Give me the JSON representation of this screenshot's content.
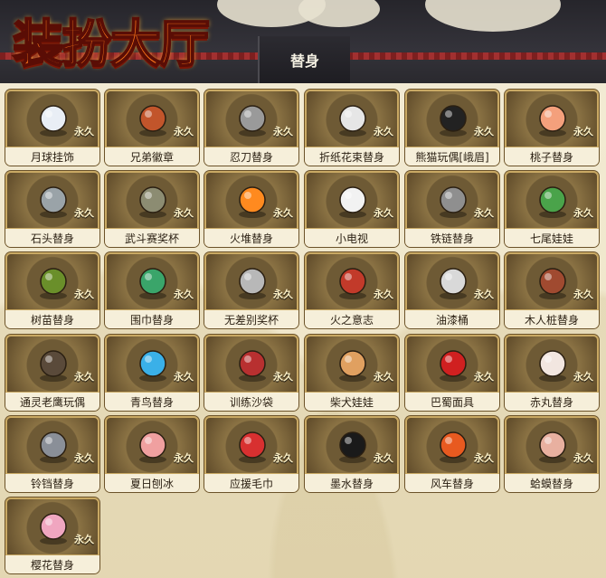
{
  "header": {
    "title": "装扮大厅",
    "tab": "替身"
  },
  "badge_label": "永久",
  "items": [
    {
      "name": "月球挂饰",
      "icon": "moon-ball-charm-icon",
      "color": "#e9eef5"
    },
    {
      "name": "兄弟徽章",
      "icon": "brother-badge-icon",
      "color": "#c2552b"
    },
    {
      "name": "忍刀替身",
      "icon": "ninja-sword-icon",
      "color": "#9a9a9a"
    },
    {
      "name": "折纸花束替身",
      "icon": "paper-bouquet-icon",
      "color": "#e6e6e6"
    },
    {
      "name": "熊猫玩偶[峨眉]",
      "icon": "panda-doll-icon",
      "color": "#222222"
    },
    {
      "name": "桃子替身",
      "icon": "peach-icon",
      "color": "#f4a07c"
    },
    {
      "name": "石头替身",
      "icon": "stone-icon",
      "color": "#9aa3a8"
    },
    {
      "name": "武斗赛奖杯",
      "icon": "trophy-icon",
      "color": "#8c8c72"
    },
    {
      "name": "火堆替身",
      "icon": "campfire-icon",
      "color": "#ff8a1f"
    },
    {
      "name": "小电视",
      "icon": "tv-mascot-icon",
      "color": "#f2f2f2"
    },
    {
      "name": "铁链替身",
      "icon": "iron-chain-icon",
      "color": "#8f8f8f"
    },
    {
      "name": "七尾娃娃",
      "icon": "seven-tails-doll-icon",
      "color": "#4aa34a"
    },
    {
      "name": "树苗替身",
      "icon": "sapling-icon",
      "color": "#6a8f2a"
    },
    {
      "name": "围巾替身",
      "icon": "scarf-icon",
      "color": "#3aa56a"
    },
    {
      "name": "无差别奖杯",
      "icon": "silver-trophy-icon",
      "color": "#b8b8b8"
    },
    {
      "name": "火之意志",
      "icon": "will-of-fire-icon",
      "color": "#c23a2a"
    },
    {
      "name": "油漆桶",
      "icon": "paint-bucket-icon",
      "color": "#d9d9d9"
    },
    {
      "name": "木人桩替身",
      "icon": "wooden-dummy-icon",
      "color": "#a04a30"
    },
    {
      "name": "通灵老鹰玩偶",
      "icon": "summon-eagle-icon",
      "color": "#5a4a3a"
    },
    {
      "name": "青鸟替身",
      "icon": "blue-bird-icon",
      "color": "#3ab0e8"
    },
    {
      "name": "训练沙袋",
      "icon": "sandbag-icon",
      "color": "#b83030"
    },
    {
      "name": "柴犬娃娃",
      "icon": "shiba-doll-icon",
      "color": "#e0a060"
    },
    {
      "name": "巴蜀面具",
      "icon": "opera-mask-icon",
      "color": "#d02020"
    },
    {
      "name": "赤丸替身",
      "icon": "akamaru-icon",
      "color": "#f2e6e0"
    },
    {
      "name": "铃铛替身",
      "icon": "bell-charm-icon",
      "color": "#8a8f98"
    },
    {
      "name": "夏日刨冰",
      "icon": "shaved-ice-icon",
      "color": "#f0a0a0"
    },
    {
      "name": "应援毛巾",
      "icon": "cheer-towel-icon",
      "color": "#d83030"
    },
    {
      "name": "墨水替身",
      "icon": "ink-splash-icon",
      "color": "#1a1a1a"
    },
    {
      "name": "风车替身",
      "icon": "pinwheel-icon",
      "color": "#e85a20"
    },
    {
      "name": "蛤蟆替身",
      "icon": "toad-icon",
      "color": "#e8b0a0"
    },
    {
      "name": "樱花替身",
      "icon": "cherry-blossom-icon",
      "color": "#f0a6c0"
    }
  ]
}
